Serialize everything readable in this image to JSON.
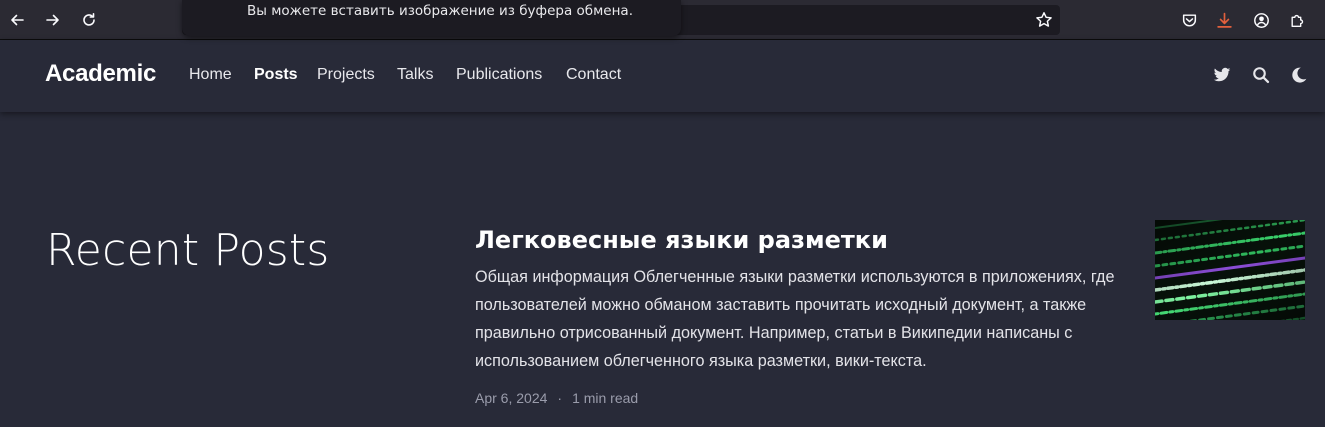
{
  "browser": {
    "toast_message": "Вы можете вставить изображение из буфера обмена."
  },
  "site": {
    "brand": "Academic",
    "nav": [
      {
        "label": "Home",
        "active": false
      },
      {
        "label": "Posts",
        "active": true
      },
      {
        "label": "Projects",
        "active": false
      },
      {
        "label": "Talks",
        "active": false
      },
      {
        "label": "Publications",
        "active": false
      },
      {
        "label": "Contact",
        "active": false
      }
    ]
  },
  "main": {
    "section_title": "Recent Posts",
    "posts": [
      {
        "title": "Легковесные языки разметки",
        "summary": "Общая информация Облегченные языки разметки используются в приложениях, где пользователей можно обманом заставить прочитать исходный документ, а также правильно отрисованный документ. Например, статьи в Википедии написаны с использованием облегченного языка разметки, вики-текста.",
        "date": "Apr 6, 2024",
        "separator": "·",
        "reading_time": "1 min read"
      }
    ]
  },
  "colors": {
    "page_bg": "#282a38",
    "browser_bg": "#2b2a33",
    "download_accent": "#e2603d",
    "meta_text": "#9a9cab"
  }
}
